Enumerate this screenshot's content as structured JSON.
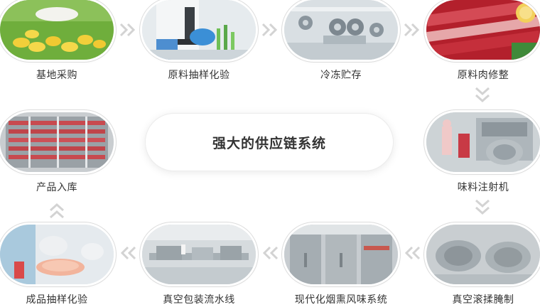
{
  "center_title": "强大的供应链系统",
  "steps": [
    {
      "label": "基地采购",
      "icon": "duck-farm-photo"
    },
    {
      "label": "原料抽样化验",
      "icon": "lab-microscope-photo"
    },
    {
      "label": "冷冻贮存",
      "icon": "cold-storage-photo"
    },
    {
      "label": "原料肉修整",
      "icon": "raw-meat-photo"
    },
    {
      "label": "味料注射机",
      "icon": "injection-machine-photo"
    },
    {
      "label": "真空滚揉腌制",
      "icon": "vacuum-tumbler-photo"
    },
    {
      "label": "现代化烟熏风味系统",
      "icon": "smokehouse-photo"
    },
    {
      "label": "真空包装流水线",
      "icon": "packaging-line-photo"
    },
    {
      "label": "成品抽样化验",
      "icon": "product-sampling-photo"
    },
    {
      "label": "产品入库",
      "icon": "warehouse-racks-photo"
    }
  ],
  "colors": {
    "arrow": "#d3d3d3",
    "pill_border": "#dcdcdc",
    "text": "#333333"
  }
}
